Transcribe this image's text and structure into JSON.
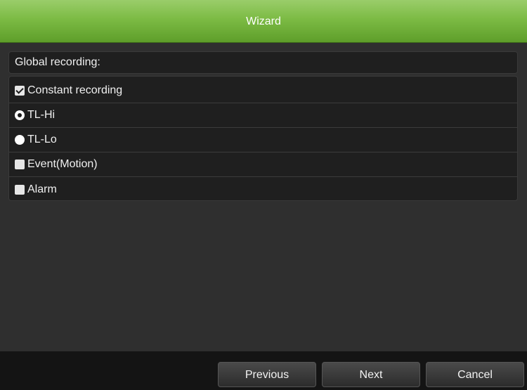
{
  "window": {
    "title": "Wizard"
  },
  "global_recording": {
    "label": "Global recording:"
  },
  "options": [
    {
      "type": "checkbox",
      "label": "Constant recording",
      "checked": true
    },
    {
      "type": "radio",
      "label": "TL-Hi",
      "checked": true
    },
    {
      "type": "radio",
      "label": "TL-Lo",
      "checked": false
    },
    {
      "type": "checkbox",
      "label": "Event(Motion)",
      "checked": false
    },
    {
      "type": "checkbox",
      "label": "Alarm",
      "checked": false
    }
  ],
  "buttons": {
    "previous": "Previous",
    "next": "Next",
    "cancel": "Cancel"
  },
  "colors": {
    "titlebar_green": "#7cbb44",
    "background": "#2f2f2f",
    "row_background": "#1f1f1f"
  }
}
